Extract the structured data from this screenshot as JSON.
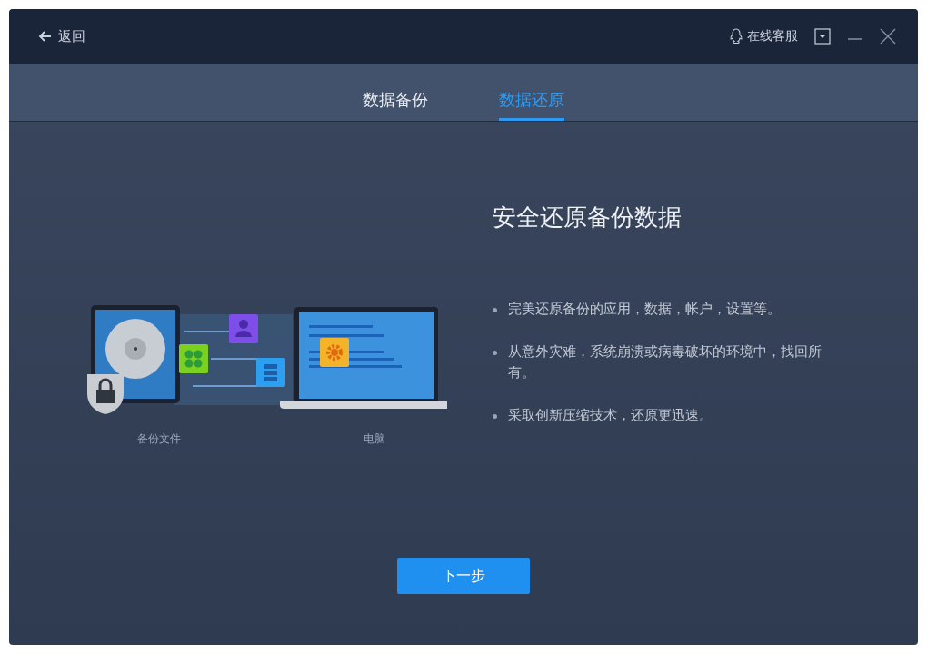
{
  "header": {
    "back_label": "返回",
    "support_label": "在线客服"
  },
  "tabs": [
    {
      "label": "数据备份",
      "selected": false
    },
    {
      "label": "数据还原",
      "selected": true
    }
  ],
  "content": {
    "heading": "安全还原备份数据",
    "illustration": {
      "source_label": "备份文件",
      "target_label": "电脑"
    },
    "bullets": [
      "完美还原备份的应用，数据，帐户，设置等。",
      "从意外灾难，系统崩溃或病毒破坏的环境中，找回所有。",
      "采取创新压缩技术，还原更迅速。"
    ]
  },
  "next_button": "下一步"
}
